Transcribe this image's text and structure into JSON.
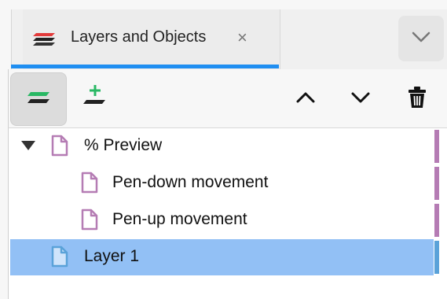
{
  "tab": {
    "label": "Layers and Objects",
    "close_glyph": "×",
    "icon": "layers-icon",
    "menu_icon": "chevron-down-icon"
  },
  "toolbar": {
    "buttons": [
      {
        "icon": "layers-icon",
        "active": true
      },
      {
        "icon": "add-layer-icon"
      },
      {
        "icon": "chevron-up-icon"
      },
      {
        "icon": "chevron-down-icon"
      },
      {
        "icon": "trash-icon"
      }
    ]
  },
  "tree": {
    "items": [
      {
        "label": "% Preview",
        "level": 0,
        "expanded": true,
        "icon": "document-icon",
        "color": "#b57cb4"
      },
      {
        "label": "Pen-down movement",
        "level": 1,
        "icon": "document-icon",
        "color": "#b57cb4"
      },
      {
        "label": "Pen-up movement",
        "level": 1,
        "icon": "document-icon",
        "color": "#b57cb4"
      },
      {
        "label": "Layer 1",
        "level": 0,
        "selected": true,
        "icon": "document-icon",
        "color": "#5aa2d9"
      }
    ]
  },
  "colors": {
    "accent": "#1f8ef1",
    "selection": "#92c0f5",
    "preview_layer": "#b57cb4",
    "layer1": "#5aa2d9",
    "logo_red": "#e23b3b",
    "logo_green": "#29b864"
  }
}
